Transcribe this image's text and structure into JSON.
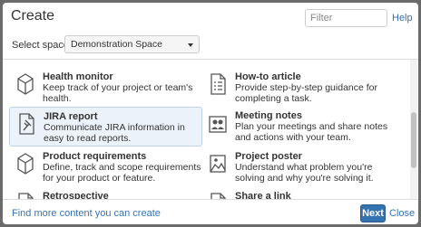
{
  "dialog": {
    "title": "Create",
    "filter_placeholder": "Filter",
    "help_label": "Help"
  },
  "space": {
    "label": "Select space",
    "selected": "Demonstration Space"
  },
  "templates": [
    {
      "name": "Health monitor",
      "desc": "Keep track of your project or team's health.",
      "icon": "health-monitor-icon"
    },
    {
      "name": "How-to article",
      "desc": "Provide step-by-step guidance for completing a task.",
      "icon": "how-to-article-icon"
    },
    {
      "name": "JIRA report",
      "desc": "Communicate JIRA information in easy to read reports.",
      "icon": "jira-report-icon",
      "selected": true
    },
    {
      "name": "Meeting notes",
      "desc": "Plan your meetings and share notes and actions with your team.",
      "icon": "meeting-notes-icon"
    },
    {
      "name": "Product requirements",
      "desc": "Define, track and scope requirements for your product or feature.",
      "icon": "product-requirements-icon"
    },
    {
      "name": "Project poster",
      "desc": "Understand what problem you're solving and why you're solving it.",
      "icon": "project-poster-icon"
    },
    {
      "name": "Retrospective",
      "desc": "",
      "icon": "retrospective-icon"
    },
    {
      "name": "Share a link",
      "desc": "",
      "icon": "share-link-icon"
    }
  ],
  "footer": {
    "more_link": "Find more content you can create",
    "next_label": "Next",
    "close_label": "Close"
  },
  "colors": {
    "accent": "#3572b0",
    "selected_bg": "#ebf2f9"
  }
}
